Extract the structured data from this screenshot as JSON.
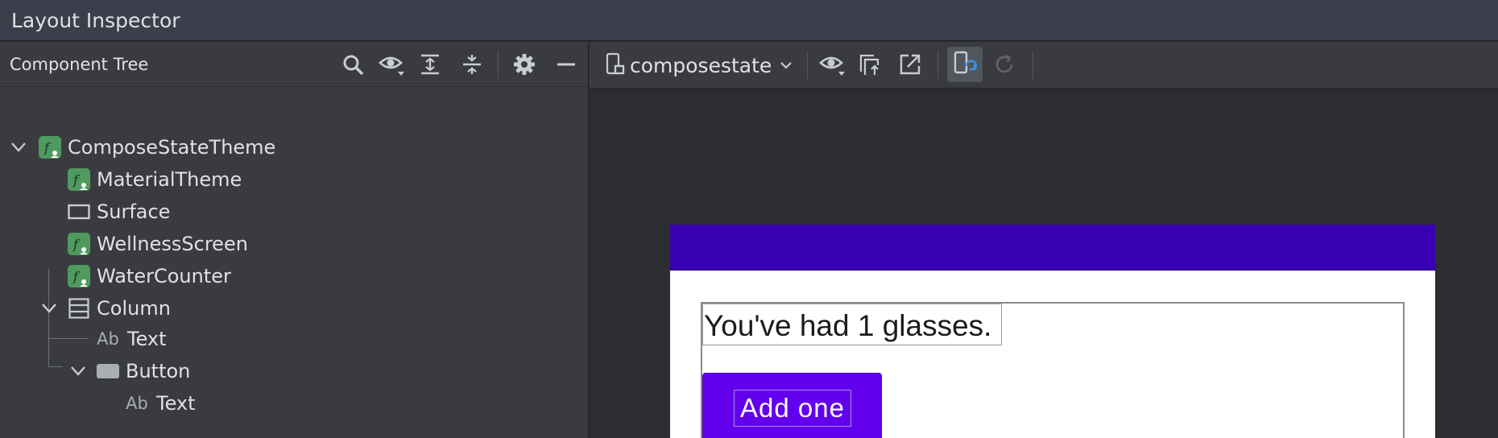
{
  "window": {
    "title": "Layout Inspector"
  },
  "component_tree": {
    "header_label": "Component Tree",
    "toolbar_icons": [
      "search-icon",
      "eye-icon",
      "expand-all-icon",
      "collapse-all-icon",
      "gear-icon",
      "minimize-icon"
    ],
    "nodes": [
      {
        "label": "ComposeStateTheme",
        "icon": "compose-function-icon",
        "expanded": true
      },
      {
        "label": "MaterialTheme",
        "icon": "compose-function-icon"
      },
      {
        "label": "Surface",
        "icon": "surface-icon"
      },
      {
        "label": "WellnessScreen",
        "icon": "compose-function-icon"
      },
      {
        "label": "WaterCounter",
        "icon": "compose-function-icon"
      },
      {
        "label": "Column",
        "icon": "column-icon",
        "expanded": true
      },
      {
        "label": "Text",
        "icon": "text-ab-icon",
        "icon_text": "Ab"
      },
      {
        "label": "Button",
        "icon": "button-icon",
        "expanded": true
      },
      {
        "label": "Text",
        "icon": "text-ab-icon",
        "icon_text": "Ab"
      }
    ]
  },
  "inspector_toolbar": {
    "device_name": "composestate",
    "icons": [
      "device-icon",
      "chevron-down-icon",
      "eye-icon",
      "snapshot-icon",
      "export-icon",
      "live-updates-icon",
      "refresh-icon"
    ]
  },
  "preview": {
    "text_content": "You've had 1 glasses.",
    "button_label": "Add one",
    "colors": {
      "app_bar": "#3700b3",
      "button": "#6200ee",
      "background": "#ffffff"
    }
  }
}
